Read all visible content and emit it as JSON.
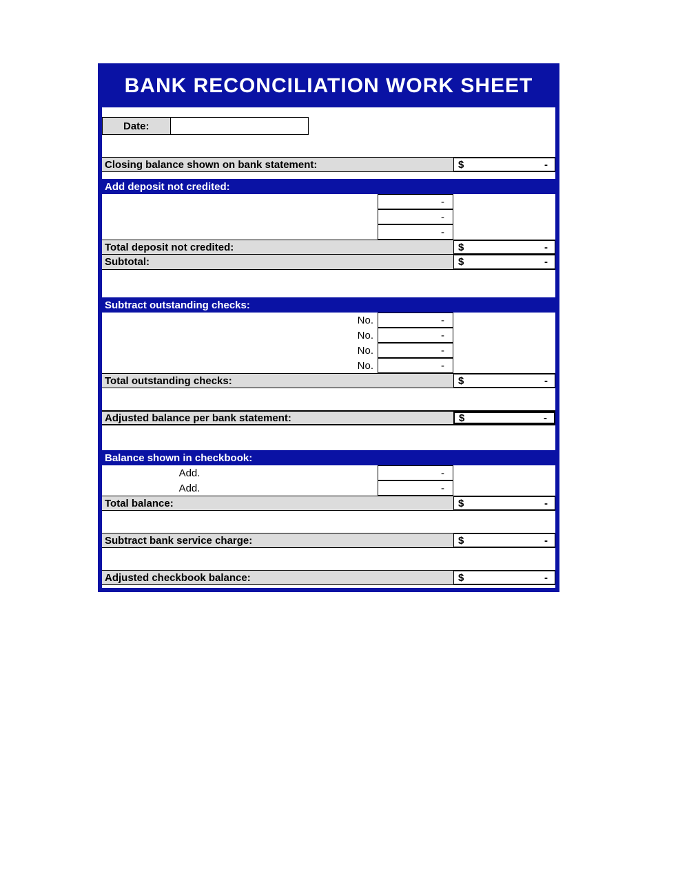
{
  "title": "BANK RECONCILIATION WORK SHEET",
  "date": {
    "label": "Date:",
    "value": ""
  },
  "currency": "$",
  "dash": "-",
  "closing_balance": {
    "label": "Closing balance shown on bank statement:",
    "value": "-"
  },
  "deposits": {
    "header": "Add deposit not credited:",
    "lines": [
      "-",
      "-",
      "-"
    ],
    "total_label": "Total deposit not credited:",
    "total_value": "-"
  },
  "subtotal": {
    "label": "Subtotal:",
    "value": "-"
  },
  "checks": {
    "header": "Subtract outstanding checks:",
    "line_prefix": "No.",
    "lines": [
      "-",
      "-",
      "-",
      "-"
    ],
    "total_label": "Total outstanding checks:",
    "total_value": "-"
  },
  "adjusted_bank": {
    "label": "Adjusted balance per bank statement:",
    "value": "-"
  },
  "checkbook": {
    "header": "Balance shown in checkbook:",
    "line_prefix": "Add.",
    "lines": [
      "-",
      "-"
    ],
    "total_label": "Total balance:",
    "total_value": "-"
  },
  "service_charge": {
    "label": "Subtract bank service charge:",
    "value": "-"
  },
  "adjusted_checkbook": {
    "label": "Adjusted checkbook balance:",
    "value": "-"
  }
}
